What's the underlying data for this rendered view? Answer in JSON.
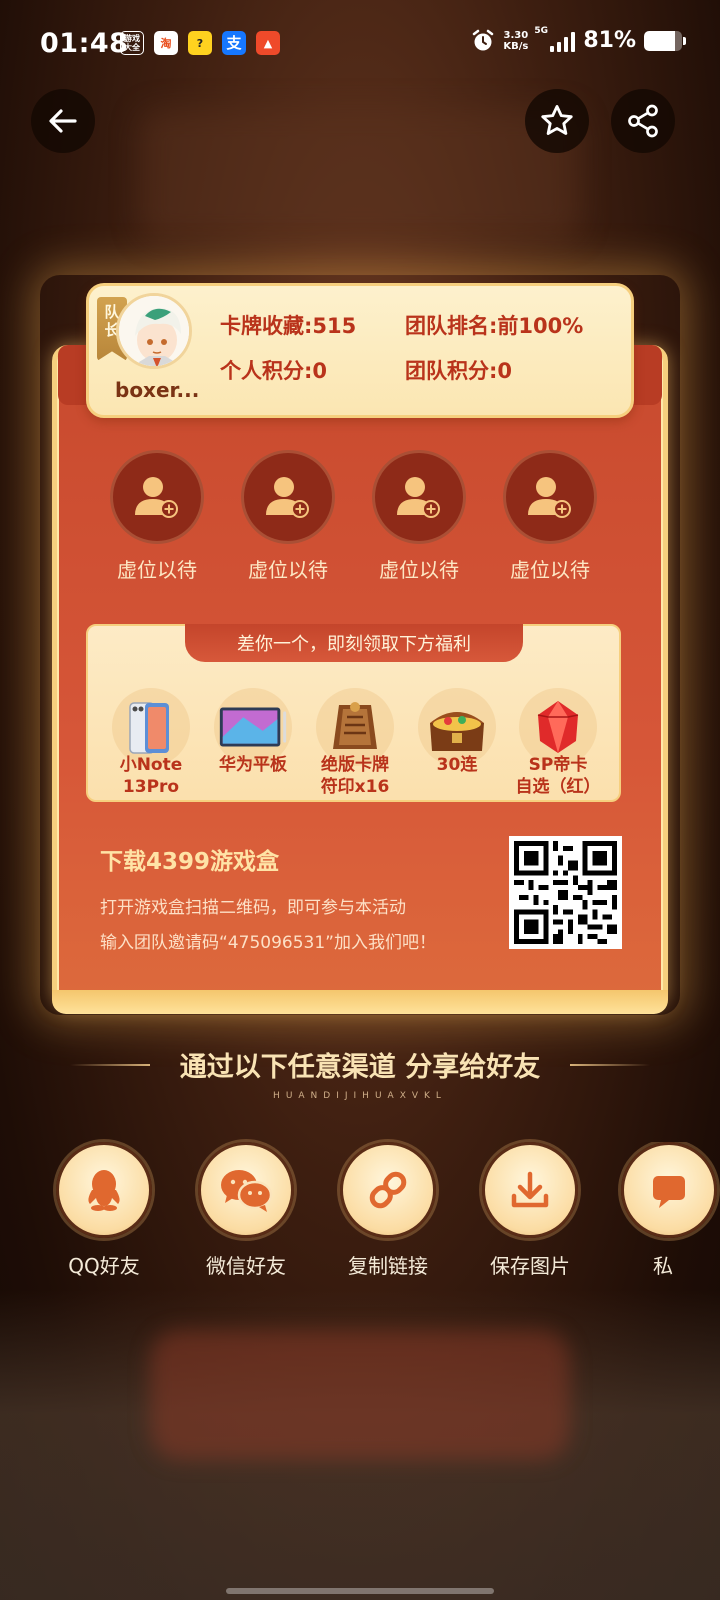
{
  "status_bar": {
    "time": "01:48",
    "notification_icons": [
      "游戏大全",
      "taobao-icon",
      "game-icon",
      "alipay-icon",
      "app-icon"
    ],
    "n1_text": "游戏\n大全",
    "n2_text": "淘",
    "n3_text": "?",
    "n4_text": "支",
    "n5_text": "▲",
    "net_speed_value": "3.30",
    "net_speed_unit": "KB/s",
    "network_type": "5G",
    "battery_percent": "81%",
    "battery_level": 0.81
  },
  "team": {
    "captain_tag": "队长",
    "captain_tag_1": "队",
    "captain_tag_2": "长",
    "username": "boxer...",
    "card_collection": "卡牌收藏:515",
    "team_rank": "团队排名:前100%",
    "personal_score": "个人积分:0",
    "team_score": "团队积分:0",
    "slots": [
      {
        "label": "虚位以待"
      },
      {
        "label": "虚位以待"
      },
      {
        "label": "虚位以待"
      },
      {
        "label": "虚位以待"
      }
    ]
  },
  "rewards": {
    "banner": "差你一个，即刻领取下方福利",
    "items": [
      {
        "label": "小Note\n13Pro",
        "icon": "phone-icon"
      },
      {
        "label": "华为平板",
        "icon": "tablet-icon"
      },
      {
        "label": "绝版卡牌\n符印x16",
        "icon": "card-seal-icon"
      },
      {
        "label": "30连",
        "icon": "treasure-chest-icon"
      },
      {
        "label": "SP帝卡\n自选（红）",
        "icon": "red-gem-icon"
      }
    ]
  },
  "download": {
    "title": "下载4399游戏盒",
    "line1": "打开游戏盒扫描二维码，即可参与本活动",
    "line2": "输入团队邀请码“475096531”加入我们吧！"
  },
  "share": {
    "title": "通过以下任意渠道 分享给好友",
    "subtitle": "HUANDIJIHUAXVKL",
    "items": [
      {
        "label": "QQ好友",
        "icon": "qq-icon"
      },
      {
        "label": "微信好友",
        "icon": "wechat-icon"
      },
      {
        "label": "复制链接",
        "icon": "link-icon"
      },
      {
        "label": "保存图片",
        "icon": "download-icon"
      },
      {
        "label": "私",
        "icon": "message-icon"
      }
    ]
  },
  "colors": {
    "card_red": "#d65638",
    "gold_border": "#f6cf7e",
    "stat_text": "#b9331b"
  }
}
